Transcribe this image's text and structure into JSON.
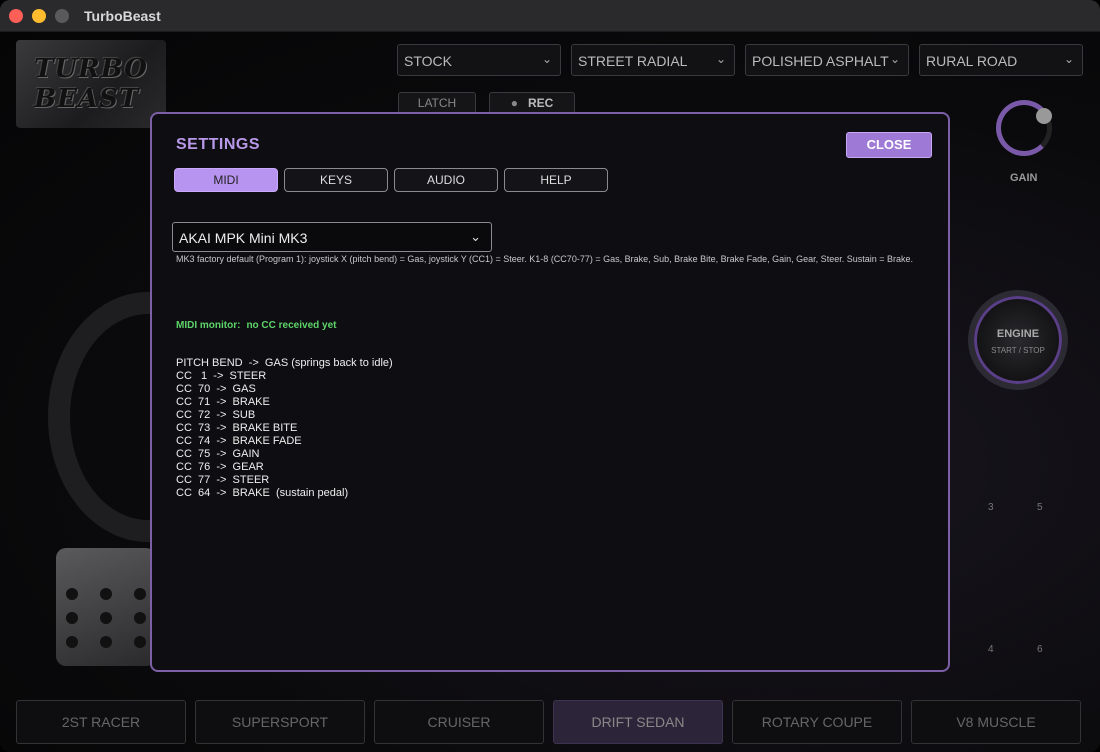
{
  "window": {
    "title": "TurboBeast"
  },
  "app": {
    "logo_text": "TURBO BEAST",
    "selectors": [
      {
        "value": "STOCK"
      },
      {
        "value": "STREET RADIAL"
      },
      {
        "value": "POLISHED ASPHALT"
      },
      {
        "value": "RURAL ROAD"
      }
    ],
    "latch_label": "LATCH",
    "rec_label": "REC",
    "gain_label": "GAIN",
    "engine": {
      "line1": "ENGINE",
      "line2": "START / STOP"
    },
    "side_numbers": [
      "3",
      "5",
      "4",
      "6"
    ],
    "cars": [
      {
        "label": "2ST RACER",
        "active": false
      },
      {
        "label": "SUPERSPORT",
        "active": false
      },
      {
        "label": "CRUISER",
        "active": false
      },
      {
        "label": "DRIFT SEDAN",
        "active": true
      },
      {
        "label": "ROTARY COUPE",
        "active": false
      },
      {
        "label": "V8 MUSCLE",
        "active": false
      }
    ]
  },
  "settings": {
    "title": "SETTINGS",
    "close_label": "CLOSE",
    "tabs": [
      {
        "label": "MIDI",
        "active": true
      },
      {
        "label": "KEYS",
        "active": false
      },
      {
        "label": "AUDIO",
        "active": false
      },
      {
        "label": "HELP",
        "active": false
      }
    ],
    "device": "AKAI MPK Mini MK3",
    "device_note": "MK3 factory default (Program 1): joystick X (pitch bend) = Gas, joystick Y (CC1) = Steer. K1-8 (CC70-77) = Gas, Brake, Sub, Brake Bite, Brake Fade, Gain, Gear, Steer. Sustain = Brake.",
    "monitor_label": "MIDI monitor:",
    "monitor_value": "no CC received yet",
    "mappings": [
      "PITCH BEND  ->  GAS (springs back to idle)",
      "CC   1  ->  STEER",
      "CC  70  ->  GAS",
      "CC  71  ->  BRAKE",
      "CC  72  ->  SUB",
      "CC  73  ->  BRAKE BITE",
      "CC  74  ->  BRAKE FADE",
      "CC  75  ->  GAIN",
      "CC  76  ->  GEAR",
      "CC  77  ->  STEER",
      "CC  64  ->  BRAKE  (sustain pedal)"
    ]
  }
}
